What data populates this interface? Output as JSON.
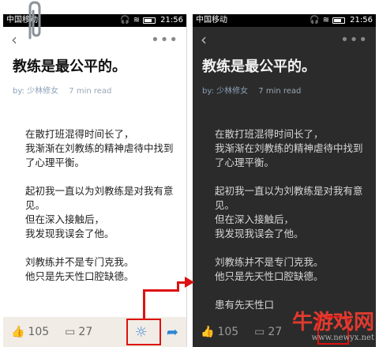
{
  "light": {
    "status": {
      "carrier": "中国移动",
      "time": "21:56"
    },
    "article": {
      "title": "教练是最公平的。",
      "author": "by: 少林修女",
      "read_time": "7 min read",
      "paragraphs": [
        [
          "在散打班混得时间长了，",
          "我渐渐在刘教练的精神虐待中找到了心理平衡。"
        ],
        [
          "起初我一直以为刘教练是对我有意见。",
          "但在深入接触后，",
          "我发现我误会了他。"
        ],
        [
          "刘教练并不是专门克我。",
          "他只是先天性口腔缺德。"
        ]
      ]
    },
    "bottom": {
      "likes": "105",
      "comments": "27"
    }
  },
  "dark": {
    "status": {
      "carrier": "中国移动",
      "time": "21:56"
    },
    "article": {
      "title": "教练是最公平的。",
      "author": "by: 少林修女",
      "read_time": "7 min read",
      "paragraphs": [
        [
          "在散打班混得时间长了，",
          "我渐渐在刘教练的精神虐待中找到了心理平衡。"
        ],
        [
          "起初我一直以为刘教练是对我有意见。",
          "但在深入接触后，",
          "我发现我误会了他。"
        ],
        [
          "刘教练并不是专门克我。",
          "他只是先天性口腔缺德。"
        ]
      ],
      "tail_text": "患有先天性口"
    },
    "bottom": {
      "likes": "105",
      "comments": "27"
    }
  },
  "watermark": {
    "main": "牛游戏网",
    "url": "www.newyx.net"
  },
  "colors": {
    "highlight": "#dd1111",
    "accent": "#2f86d4"
  }
}
